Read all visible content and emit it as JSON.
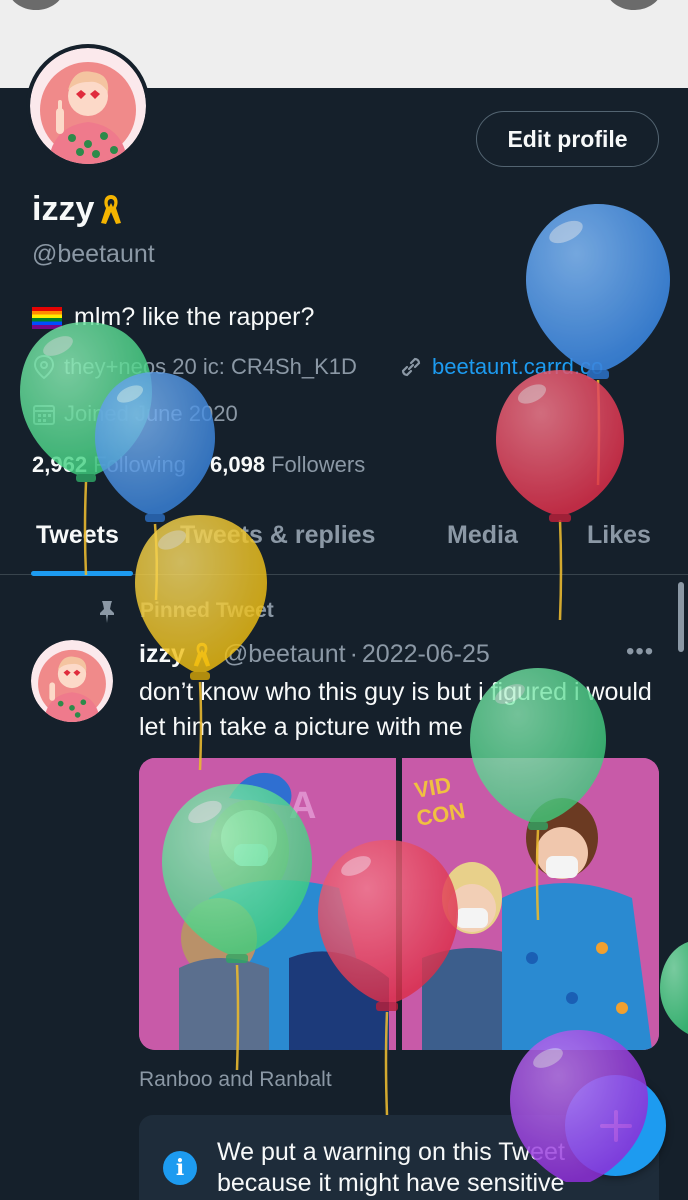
{
  "profile": {
    "name": "izzy",
    "name_emoji": "ribbon",
    "handle": "@beetaunt",
    "edit_label": "Edit profile",
    "bio_flag": "rainbow-flag",
    "bio": "mlm? like the rapper?",
    "location": "they+neos 20 ic: CR4Sh_K1D",
    "website": "beetaunt.carrd.co",
    "joined": "Joined June 2020",
    "following_count": "2,962",
    "following_label": "Following",
    "followers_count": "6,098",
    "followers_label": "Followers"
  },
  "tabs": [
    {
      "label": "Tweets",
      "active": true
    },
    {
      "label": "Tweets & replies",
      "active": false
    },
    {
      "label": "Media",
      "active": false
    },
    {
      "label": "Likes",
      "active": false
    }
  ],
  "pinned_tweet": {
    "pinned_label": "Pinned Tweet",
    "author_name": "izzy",
    "author_handle": "@beetaunt",
    "separator": "·",
    "date": "2022-06-25",
    "more": "•••",
    "text": "don’t know who this guy is but i figured i would let him take a picture with me",
    "caption": "Ranboo and Ranbalt",
    "warning": "We put a warning on this Tweet because it might have sensitive"
  },
  "colors": {
    "background": "#15202b",
    "accent": "#1d9bf0",
    "secondary_text": "#8b98a5",
    "balloon_green": "#4fd68c",
    "balloon_blue": "#3f8be0",
    "balloon_red": "#e0364f",
    "balloon_yellow": "#f2c31b",
    "balloon_purple": "#9b3ce0"
  }
}
